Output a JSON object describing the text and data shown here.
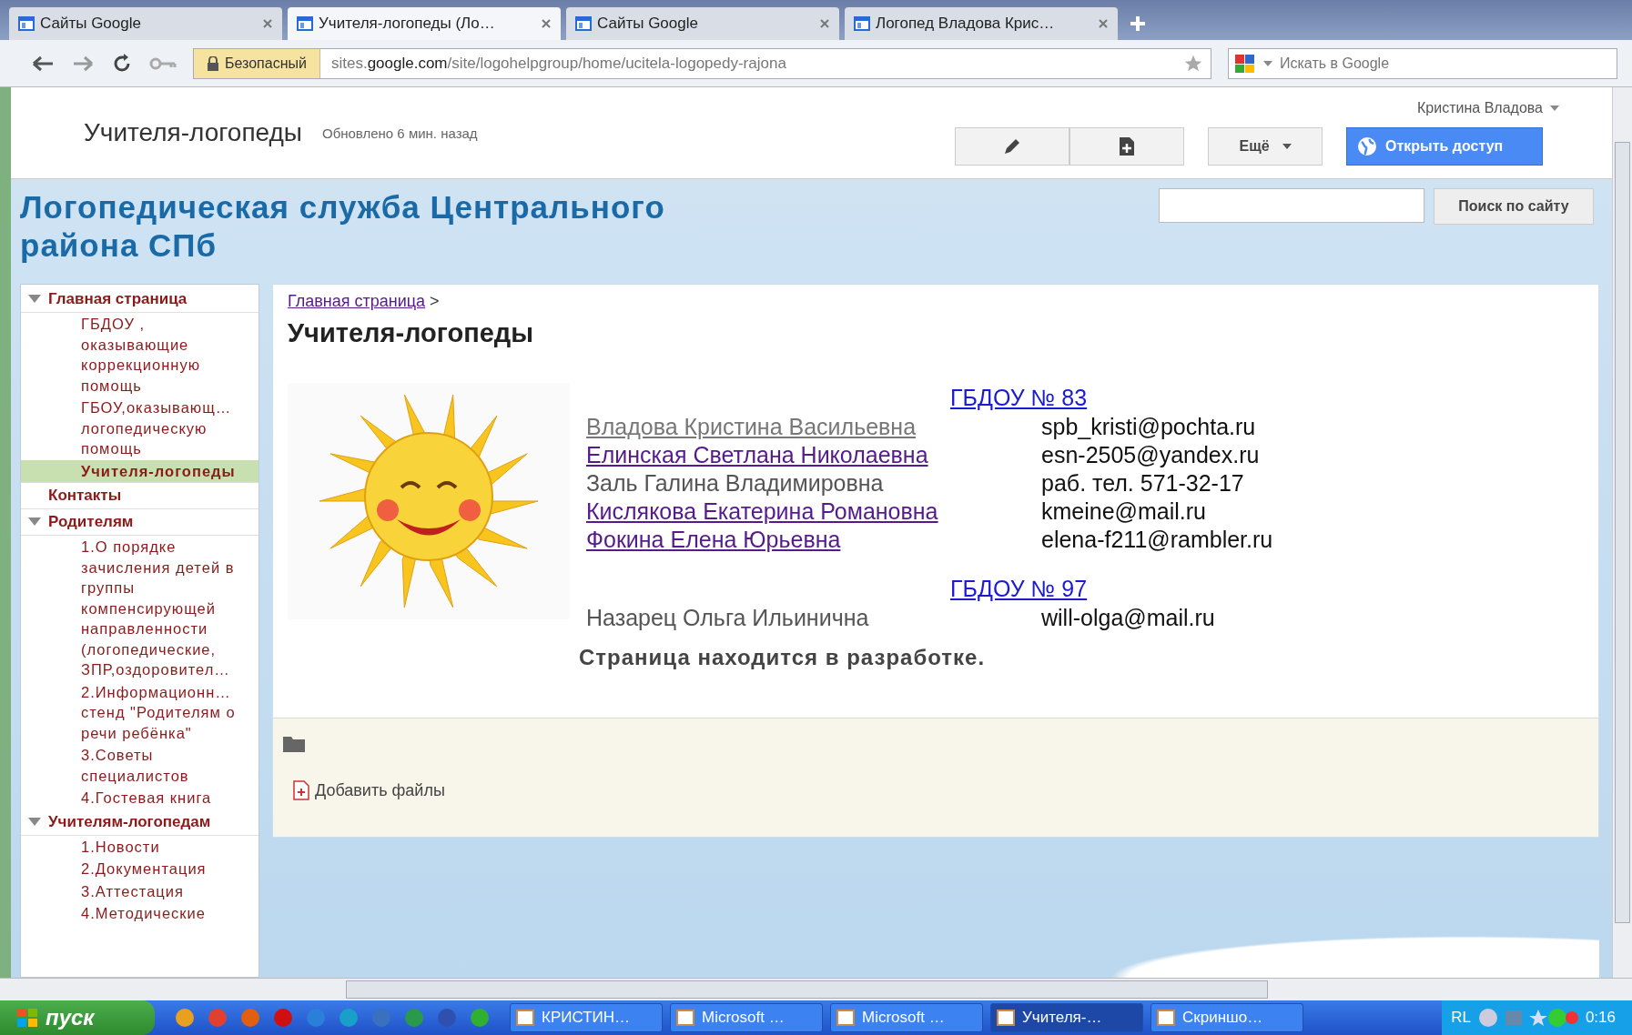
{
  "tabs": [
    {
      "title": "Сайты Google",
      "selected": false
    },
    {
      "title": "Учителя-логопеды (Ло…",
      "selected": true
    },
    {
      "title": "Сайты Google",
      "selected": false
    },
    {
      "title": "Логопед Владова Крис…",
      "selected": false
    }
  ],
  "address_bar": {
    "security_label": "Безопасный",
    "url_prefix": "sites.",
    "url_domain": "google.com",
    "url_path": "/site/logohelpgroup/home/ucitela-logopedy-rajona",
    "search_placeholder": "Искать в Google"
  },
  "site_header": {
    "page_title": "Учителя-логопеды",
    "updated": "Обновлено 6 мин. назад",
    "user": "Кристина Владова",
    "more_button": "Ещё",
    "share_button": "Открыть доступ"
  },
  "banner": {
    "site_title": "Логопедическая служба Центрального района СПб",
    "search_button": "Поиск по сайту"
  },
  "sidebar": {
    "items": [
      {
        "label": "Главная страница",
        "expanded": true,
        "selected": false,
        "children": [
          {
            "label": "ГБДОУ , оказывающие коррекционную помощь",
            "selected": false
          },
          {
            "label": "ГБОУ,оказывающ… логопедическую помощь",
            "selected": false
          },
          {
            "label": "Учителя-логопеды",
            "selected": true
          }
        ]
      },
      {
        "label": "Контакты",
        "expanded": false,
        "selected": false
      },
      {
        "label": "Родителям",
        "expanded": true,
        "selected": false,
        "children": [
          {
            "label": "1.О порядке зачисления детей в группы компенсирующей направленности (логопедические, ЗПР,оздоровител…",
            "selected": false
          },
          {
            "label": "2.Информационн… стенд \"Родителям о речи ребёнка\"",
            "selected": false
          },
          {
            "label": "3.Советы специалистов",
            "selected": false
          },
          {
            "label": "4.Гостевая книга",
            "selected": false
          }
        ]
      },
      {
        "label": "Учителям-логопедам",
        "expanded": true,
        "selected": false,
        "children": [
          {
            "label": "1.Новости",
            "selected": false
          },
          {
            "label": "2.Документация",
            "selected": false
          },
          {
            "label": "3.Аттестация",
            "selected": false
          },
          {
            "label": "4.Методические",
            "selected": false
          }
        ]
      }
    ]
  },
  "content": {
    "breadcrumb": "Главная страница",
    "breadcrumb_separator": ">",
    "heading": "Учителя-логопеды",
    "schools": [
      {
        "name": "ГБДОУ № 83",
        "staff": [
          {
            "name": "Владова Кристина Васильевна",
            "kind": "visited",
            "contact": "spb_kristi@pochta.ru"
          },
          {
            "name": "Елинская Светлана Николаевна",
            "kind": "link",
            "contact": "esn-2505@yandex.ru"
          },
          {
            "name": "Заль Галина Владимировна",
            "kind": "text",
            "contact": "раб. тел. 571-32-17"
          },
          {
            "name": "Кислякова Екатерина Романовна",
            "kind": "link",
            "contact": "kmeine@mail.ru"
          },
          {
            "name": "Фокина  Елена Юрьевна",
            "kind": "link",
            "contact": "elena-f211@rambler.ru"
          }
        ]
      },
      {
        "name": "ГБДОУ № 97",
        "staff": [
          {
            "name": "Назарец Ольга Ильинична",
            "kind": "text",
            "contact": "will-olga@mail.ru"
          }
        ]
      }
    ],
    "status": "Страница находится в разработке.",
    "add_files": "Добавить файлы"
  },
  "taskbar": {
    "start": "пуск",
    "quick_launch": [
      {
        "color": "#e8a020"
      },
      {
        "color": "#e04030"
      },
      {
        "color": "#e06010"
      },
      {
        "color": "#d01010"
      },
      {
        "color": "#2a7fd8"
      },
      {
        "color": "#18a0c8"
      },
      {
        "color": "#3a70c0"
      },
      {
        "color": "#2a9a4a"
      },
      {
        "color": "#3050b0"
      },
      {
        "color": "#30b030"
      }
    ],
    "tasks": [
      {
        "label": "КРИСТИН…",
        "selected": false
      },
      {
        "label": "Microsoft …",
        "selected": false
      },
      {
        "label": "Microsoft …",
        "selected": false
      },
      {
        "label": "Учителя-…",
        "selected": true
      },
      {
        "label": "Скриншо…",
        "selected": false
      }
    ],
    "language": "RL",
    "clock": "0:16"
  }
}
